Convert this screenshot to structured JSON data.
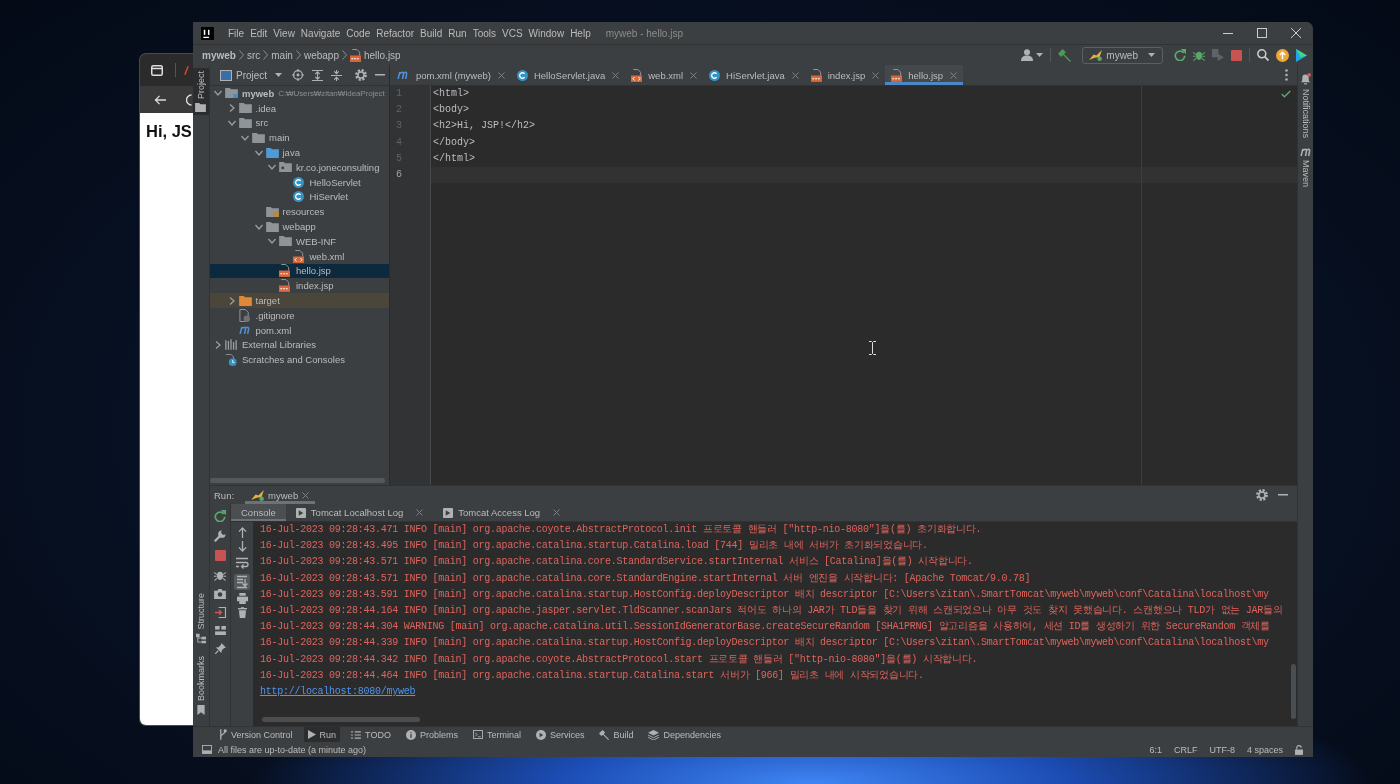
{
  "browser_window": {
    "heading": "Hi, JS"
  },
  "window": {
    "title": "myweb - hello.jsp",
    "menu": [
      "File",
      "Edit",
      "View",
      "Navigate",
      "Code",
      "Refactor",
      "Build",
      "Run",
      "Tools",
      "VCS",
      "Window",
      "Help"
    ]
  },
  "navigation_bar": {
    "breadcrumbs": [
      {
        "label": "myweb",
        "kind": "project"
      },
      {
        "label": "src",
        "kind": "folder"
      },
      {
        "label": "main",
        "kind": "folder"
      },
      {
        "label": "webapp",
        "kind": "folder"
      },
      {
        "label": "hello.jsp",
        "kind": "jsp"
      }
    ],
    "run_configuration": "myweb"
  },
  "left_stripe": {
    "top": [
      {
        "label": "Project",
        "kind": "project",
        "selected": true
      }
    ],
    "bottom": [
      {
        "label": "Structure",
        "kind": "structure",
        "selected": false
      },
      {
        "label": "Bookmarks",
        "kind": "bookmarks",
        "selected": false
      }
    ]
  },
  "project_panel": {
    "title": "Project",
    "tree": [
      {
        "label": "myweb",
        "kind": "module",
        "note": "C:₩Users₩zitan₩IdeaProject",
        "expanded": true,
        "selected": false,
        "children": [
          {
            "label": ".idea",
            "kind": "folder",
            "expanded": false,
            "selected": false
          },
          {
            "label": "src",
            "kind": "folder",
            "expanded": true,
            "selected": false,
            "children": [
              {
                "label": "main",
                "kind": "folder",
                "expanded": true,
                "selected": false,
                "children": [
                  {
                    "label": "java",
                    "kind": "source-folder",
                    "expanded": true,
                    "selected": false,
                    "children": [
                      {
                        "label": "kr.co.joneconsulting",
                        "kind": "package",
                        "expanded": true,
                        "selected": false,
                        "children": [
                          {
                            "label": "HelloServlet",
                            "kind": "class",
                            "selected": false
                          },
                          {
                            "label": "HiServlet",
                            "kind": "class",
                            "selected": false
                          }
                        ]
                      }
                    ]
                  },
                  {
                    "label": "resources",
                    "kind": "resources-folder",
                    "selected": false
                  },
                  {
                    "label": "webapp",
                    "kind": "folder",
                    "expanded": true,
                    "selected": false,
                    "children": [
                      {
                        "label": "WEB-INF",
                        "kind": "folder",
                        "expanded": true,
                        "selected": false,
                        "children": [
                          {
                            "label": "web.xml",
                            "kind": "xml",
                            "selected": false
                          }
                        ]
                      },
                      {
                        "label": "hello.jsp",
                        "kind": "jsp",
                        "selected": true
                      },
                      {
                        "label": "index.jsp",
                        "kind": "jsp",
                        "selected": false
                      }
                    ]
                  }
                ]
              }
            ]
          },
          {
            "label": "target",
            "kind": "excluded-folder",
            "expanded": false,
            "selected": false
          },
          {
            "label": ".gitignore",
            "kind": "gitignore",
            "selected": false
          },
          {
            "label": "pom.xml",
            "kind": "maven",
            "selected": false
          }
        ]
      },
      {
        "label": "External Libraries",
        "kind": "libraries",
        "expanded": false,
        "selected": false
      },
      {
        "label": "Scratches and Consoles",
        "kind": "scratches",
        "selected": false
      }
    ]
  },
  "editor": {
    "tabs": [
      {
        "label": "pom.xml (myweb)",
        "kind": "maven",
        "selected": false
      },
      {
        "label": "HelloServlet.java",
        "kind": "class",
        "selected": false
      },
      {
        "label": "web.xml",
        "kind": "xml",
        "selected": false
      },
      {
        "label": "HiServlet.java",
        "kind": "class",
        "selected": false
      },
      {
        "label": "index.jsp",
        "kind": "jsp",
        "selected": false
      },
      {
        "label": "hello.jsp",
        "kind": "jsp",
        "selected": true
      }
    ],
    "lines": [
      {
        "number": "1",
        "text": "<html>",
        "current": false
      },
      {
        "number": "2",
        "text": "<body>",
        "current": false
      },
      {
        "number": "3",
        "text": "<h2>Hi, JSP!</h2>",
        "current": false
      },
      {
        "number": "4",
        "text": "</body>",
        "current": false
      },
      {
        "number": "5",
        "text": "</html>",
        "current": false
      },
      {
        "number": "6",
        "current": true
      }
    ]
  },
  "right_stripe": [
    {
      "label": "Notifications",
      "kind": "notifications"
    },
    {
      "label": "Maven",
      "kind": "maven"
    }
  ],
  "run_panel": {
    "label": "Run:",
    "tabs": [
      {
        "label": "myweb",
        "selected": true
      }
    ],
    "console_tabs": [
      {
        "label": "Console",
        "kind": "console",
        "selected": true
      },
      {
        "label": "Tomcat Localhost Log",
        "kind": "log",
        "selected": false
      },
      {
        "label": "Tomcat Access Log",
        "kind": "log",
        "selected": false
      }
    ],
    "soft_wrap": false,
    "scroll_to_end": true,
    "console": [
      {
        "kind": "stderr",
        "text": "16-Jul-2023 09:28:43.471 INFO [main] org.apache.coyote.AbstractProtocol.init 프로토콜 핸들러 [\"http-nio-8080\"]을(를) 초기화합니다."
      },
      {
        "kind": "stderr",
        "text": "16-Jul-2023 09:28:43.495 INFO [main] org.apache.catalina.startup.Catalina.load [744] 밀리초 내에 서버가 초기화되었습니다."
      },
      {
        "kind": "stderr",
        "text": "16-Jul-2023 09:28:43.571 INFO [main] org.apache.catalina.core.StandardService.startInternal 서비스 [Catalina]을(를) 시작합니다."
      },
      {
        "kind": "stderr",
        "text": "16-Jul-2023 09:28:43.571 INFO [main] org.apache.catalina.core.StandardEngine.startInternal 서버 엔진을 시작합니다: [Apache Tomcat/9.0.78]"
      },
      {
        "kind": "stderr",
        "text": "16-Jul-2023 09:28:43.591 INFO [main] org.apache.catalina.startup.HostConfig.deployDescriptor 배치 descriptor [C:\\Users\\zitan\\.SmartTomcat\\myweb\\myweb\\conf\\Catalina\\localhost\\my"
      },
      {
        "kind": "stderr",
        "text": "16-Jul-2023 09:28:44.164 INFO [main] org.apache.jasper.servlet.TldScanner.scanJars 적어도 하나의 JAR가 TLD들을 찾기 위해 스캔되었으나 아무 것도 찾지 못했습니다. 스캔했으나 TLD가 없는 JAR들의"
      },
      {
        "kind": "stderr",
        "text": "16-Jul-2023 09:28:44.304 WARNING [main] org.apache.catalina.util.SessionIdGeneratorBase.createSecureRandom [SHA1PRNG] 알고리즘을 사용하여, 세션 ID를 생성하기 위한 SecureRandom 객체를"
      },
      {
        "kind": "stderr",
        "text": "16-Jul-2023 09:28:44.339 INFO [main] org.apache.catalina.startup.HostConfig.deployDescriptor 배치 descriptor [C:\\Users\\zitan\\.SmartTomcat\\myweb\\myweb\\conf\\Catalina\\localhost\\my"
      },
      {
        "kind": "stderr",
        "text": "16-Jul-2023 09:28:44.342 INFO [main] org.apache.coyote.AbstractProtocol.start 프로토콜 핸들러 [\"http-nio-8080\"]을(를) 시작합니다."
      },
      {
        "kind": "stderr",
        "text": "16-Jul-2023 09:28:44.464 INFO [main] org.apache.catalina.startup.Catalina.start 서버가 [966] 밀리초 내에 시작되었습니다."
      },
      {
        "kind": "link",
        "text": "http://localhost:8080/myweb"
      }
    ]
  },
  "tool_window_bar": [
    {
      "label": "Version Control",
      "kind": "vcs",
      "selected": false
    },
    {
      "label": "Run",
      "kind": "run",
      "selected": true
    },
    {
      "label": "TODO",
      "kind": "todo",
      "selected": false
    },
    {
      "label": "Problems",
      "kind": "problems",
      "selected": false
    },
    {
      "label": "Terminal",
      "kind": "terminal",
      "selected": false
    },
    {
      "label": "Services",
      "kind": "services",
      "selected": false
    },
    {
      "label": "Build",
      "kind": "build",
      "selected": false
    },
    {
      "label": "Dependencies",
      "kind": "dependencies",
      "selected": false
    }
  ],
  "status_bar": {
    "message": "All files are up-to-date (a minute ago)",
    "items": [
      "6:1",
      "CRLF",
      "UTF-8",
      "4 spaces"
    ]
  }
}
